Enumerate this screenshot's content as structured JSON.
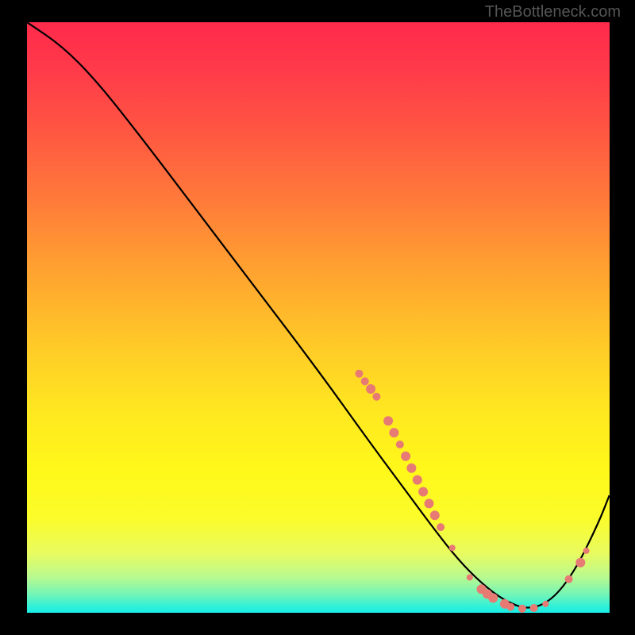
{
  "watermark": "TheBottleneck.com",
  "chart_data": {
    "type": "line",
    "title": "",
    "xlabel": "",
    "ylabel": "",
    "xlim": [
      0,
      100
    ],
    "ylim": [
      0,
      100
    ],
    "series": [
      {
        "name": "curve",
        "x": [
          0,
          6,
          12,
          20,
          30,
          40,
          50,
          58,
          64,
          70,
          74,
          78,
          82,
          86,
          90,
          94,
          98,
          100
        ],
        "y": [
          100,
          96,
          90,
          80,
          67,
          54,
          41,
          30,
          22,
          14,
          9,
          5,
          2,
          0.5,
          2,
          7,
          15,
          20
        ]
      }
    ],
    "markers": [
      {
        "x": 57,
        "y": 40.5,
        "r": 5
      },
      {
        "x": 58,
        "y": 39.2,
        "r": 5
      },
      {
        "x": 59,
        "y": 37.9,
        "r": 6
      },
      {
        "x": 60,
        "y": 36.6,
        "r": 5
      },
      {
        "x": 62,
        "y": 32.5,
        "r": 6
      },
      {
        "x": 63,
        "y": 30.5,
        "r": 6
      },
      {
        "x": 64,
        "y": 28.5,
        "r": 5
      },
      {
        "x": 65,
        "y": 26.5,
        "r": 6
      },
      {
        "x": 66,
        "y": 24.5,
        "r": 6
      },
      {
        "x": 67,
        "y": 22.5,
        "r": 6
      },
      {
        "x": 68,
        "y": 20.5,
        "r": 6
      },
      {
        "x": 69,
        "y": 18.5,
        "r": 6
      },
      {
        "x": 70,
        "y": 16.5,
        "r": 6
      },
      {
        "x": 71,
        "y": 14.5,
        "r": 5
      },
      {
        "x": 73,
        "y": 11.0,
        "r": 4
      },
      {
        "x": 76,
        "y": 6.0,
        "r": 4
      },
      {
        "x": 78,
        "y": 4.0,
        "r": 6
      },
      {
        "x": 79,
        "y": 3.2,
        "r": 6
      },
      {
        "x": 80,
        "y": 2.5,
        "r": 6
      },
      {
        "x": 82,
        "y": 1.5,
        "r": 6
      },
      {
        "x": 83,
        "y": 1.0,
        "r": 5
      },
      {
        "x": 85,
        "y": 0.7,
        "r": 5
      },
      {
        "x": 87,
        "y": 0.8,
        "r": 5
      },
      {
        "x": 89,
        "y": 1.5,
        "r": 4
      },
      {
        "x": 93,
        "y": 5.7,
        "r": 5
      },
      {
        "x": 95,
        "y": 8.5,
        "r": 6
      },
      {
        "x": 96,
        "y": 10.5,
        "r": 4
      }
    ],
    "gradient_colors": {
      "top": "#ff2a4b",
      "mid_upper": "#ffa230",
      "mid": "#ffe820",
      "mid_lower": "#e8fb60",
      "bottom": "#18eee8"
    },
    "curve_color": "#000000",
    "marker_color": "#e87a74"
  }
}
